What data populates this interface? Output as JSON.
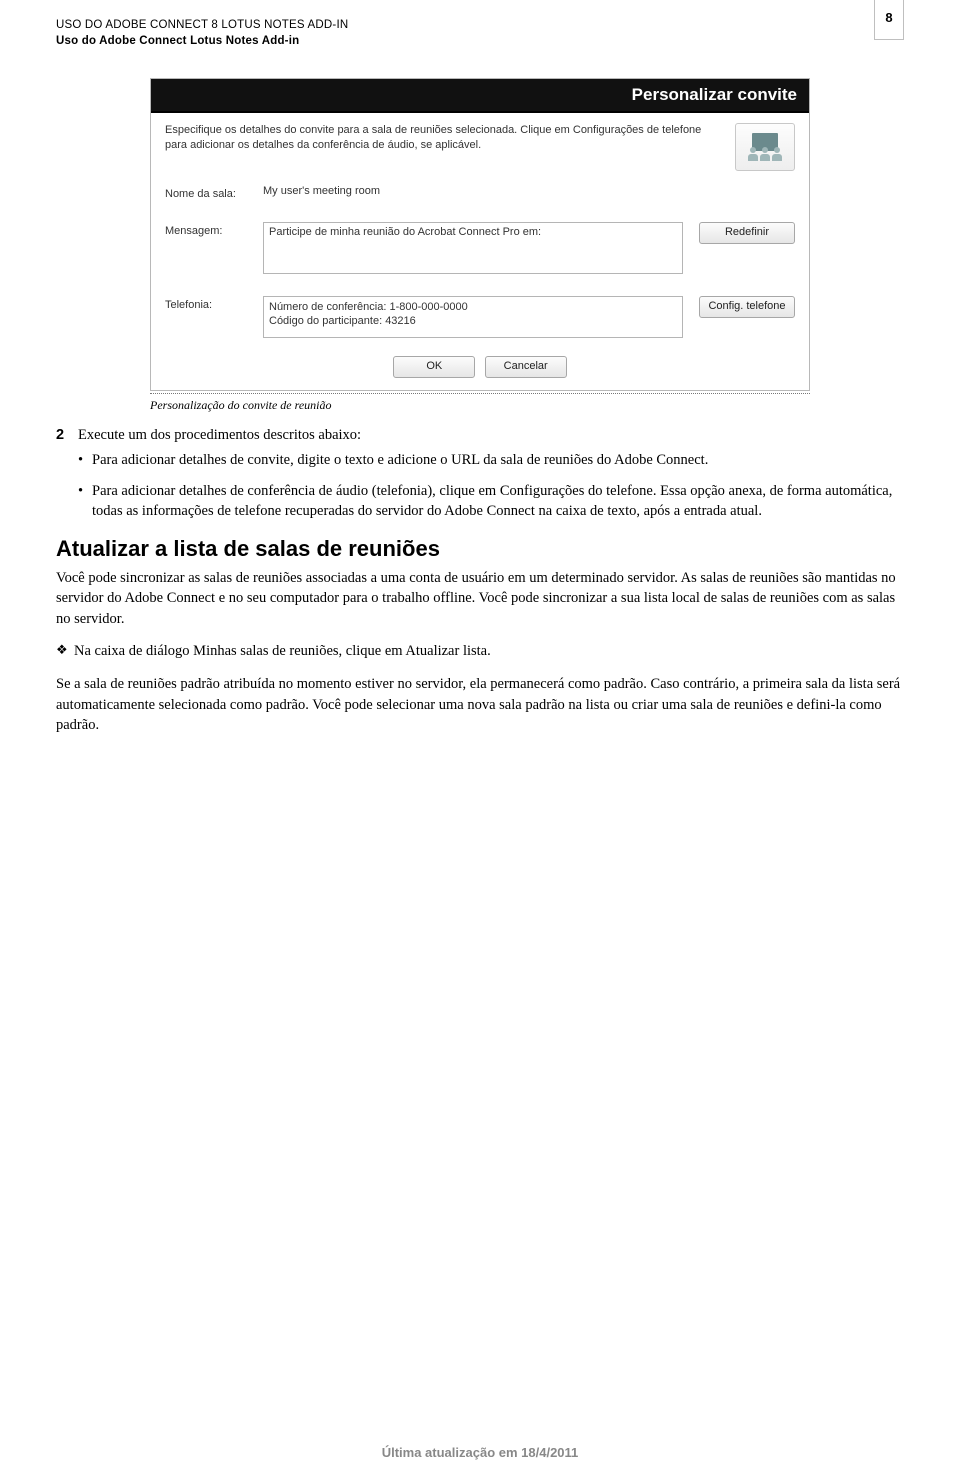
{
  "header": {
    "line1": "USO DO ADOBE CONNECT 8 LOTUS NOTES ADD-IN",
    "line2": "Uso do Adobe Connect Lotus Notes Add-in",
    "page_number": "8"
  },
  "dialog": {
    "title": "Personalizar convite",
    "description": "Especifique os detalhes do convite para a sala de reuniões selecionada. Clique em Configurações de telefone para adicionar os detalhes da conferência de áudio, se aplicável.",
    "room_label": "Nome da sala:",
    "room_value": "My user's meeting room",
    "message_label": "Mensagem:",
    "message_value": "Participe de minha reunião do Acrobat Connect Pro em:",
    "reset_button": "Redefinir",
    "tel_label": "Telefonia:",
    "tel_line1": "Número de conferência: 1-800-000-0000",
    "tel_line2": "Código do participante: 43216",
    "tel_config_button": "Config. telefone",
    "ok_button": "OK",
    "cancel_button": "Cancelar"
  },
  "caption": "Personalização do convite de reunião",
  "step": {
    "number": "2",
    "text": "Execute um dos procedimentos descritos abaixo:"
  },
  "bullets": [
    "Para adicionar detalhes de convite, digite o texto e adicione o URL da sala de reuniões do Adobe Connect.",
    "Para adicionar detalhes de conferência de áudio (telefonia), clique em Configurações do telefone. Essa opção anexa, de forma automática, todas as informações de telefone recuperadas do servidor do Adobe Connect na caixa de texto, após a entrada atual."
  ],
  "section_title": "Atualizar a lista de salas de reuniões",
  "p1": "Você pode sincronizar as salas de reuniões associadas a uma conta de usuário em um determinado servidor. As salas de reuniões são mantidas no servidor do Adobe Connect e no seu computador para o trabalho offline. Você pode sincronizar a sua lista local de salas de reuniões com as salas no servidor.",
  "diamond": "Na caixa de diálogo Minhas salas de reuniões, clique em Atualizar lista.",
  "p2": "Se a sala de reuniões padrão atribuída no momento estiver no servidor, ela permanecerá como padrão. Caso contrário, a primeira sala da lista será automaticamente selecionada como padrão. Você pode selecionar uma nova sala padrão na lista ou criar uma sala de reuniões e defini-la como padrão.",
  "footer": "Última atualização em 18/4/2011"
}
